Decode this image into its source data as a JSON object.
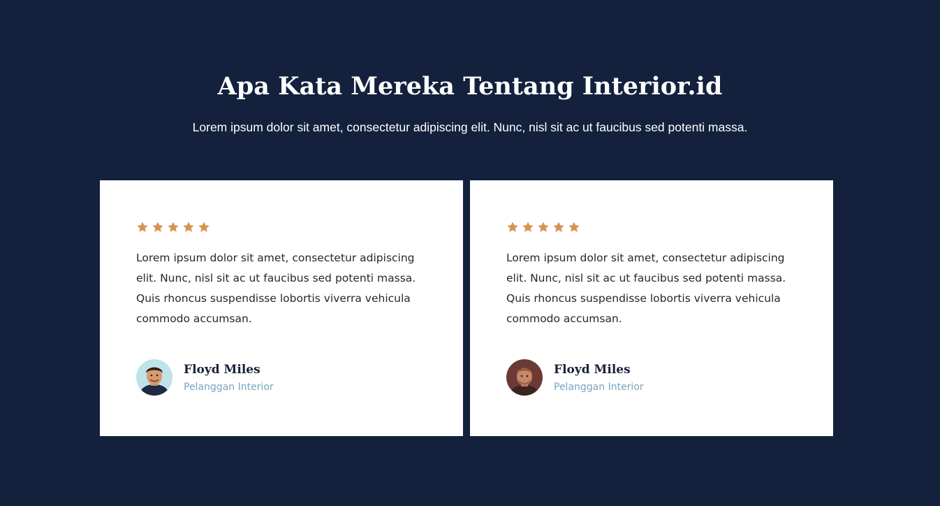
{
  "colors": {
    "background": "#13213d",
    "card": "#ffffff",
    "star": "#d69451",
    "role_text": "#7aa3bf"
  },
  "section": {
    "title": "Apa Kata Mereka Tentang Interior.id",
    "subtitle": "Lorem ipsum dolor sit amet, consectetur adipiscing elit. Nunc, nisl sit ac ut faucibus sed potenti massa."
  },
  "testimonials": [
    {
      "rating": 5,
      "quote": "Lorem ipsum dolor sit amet, consectetur adipiscing elit. Nunc, nisl sit ac ut faucibus sed potenti massa. Quis rhoncus suspendisse lobortis viverra vehicula commodo accumsan.",
      "name": "Floyd Miles",
      "role": "Pelanggan Interior",
      "avatar_icon": "person-avatar"
    },
    {
      "rating": 5,
      "quote": "Lorem ipsum dolor sit amet, consectetur adipiscing elit. Nunc, nisl sit ac ut faucibus sed potenti massa. Quis rhoncus suspendisse lobortis viverra vehicula commodo accumsan.",
      "name": "Floyd Miles",
      "role": "Pelanggan Interior",
      "avatar_icon": "person-avatar"
    }
  ]
}
